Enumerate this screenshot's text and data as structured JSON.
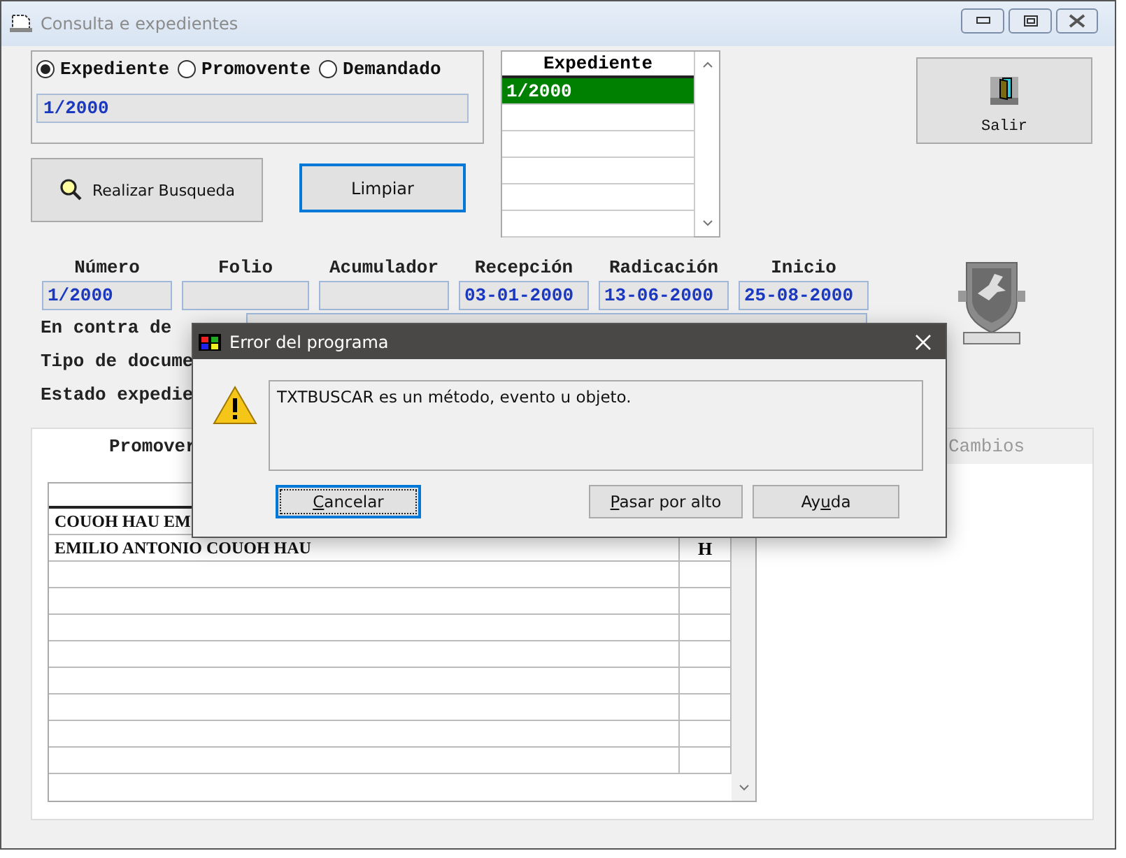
{
  "window": {
    "title": "Consulta e expedientes"
  },
  "search": {
    "options": [
      {
        "label": "Expediente",
        "selected": true
      },
      {
        "label": "Promovente",
        "selected": false
      },
      {
        "label": "Demandado",
        "selected": false
      }
    ],
    "value": "1/2000"
  },
  "search_button": {
    "label": "Realizar Busqueda"
  },
  "clear_button": {
    "label": "Limpiar",
    "focused": true
  },
  "exit_button": {
    "label": "Salir"
  },
  "expediente_list": {
    "header": "Expediente",
    "rows": [
      {
        "text": "1/2000",
        "selected": true
      }
    ]
  },
  "fields": [
    {
      "label": "Número",
      "value": "1/2000"
    },
    {
      "label": "Folio"
    },
    {
      "label": "Acumulador"
    },
    {
      "label": "Recepción",
      "value": "03-01-2000"
    },
    {
      "label": "Radicación",
      "value": "13-06-2000"
    },
    {
      "label": "Inicio",
      "value": "25-08-2000"
    }
  ],
  "info_labels": [
    "En contra de",
    "Tipo de docume",
    "Estado expedie"
  ],
  "tabs": [
    {
      "label": "Promover",
      "selected": true
    },
    {
      "label": "Cambios",
      "selected": false
    }
  ],
  "grid_rows": [
    {
      "name": "COUOH HAU EM"
    },
    {
      "name": "EMILIO ANTONIO COUOH HAU",
      "column_2": "H"
    }
  ],
  "dialog": {
    "title": "Error del programa",
    "message": "TXTBUSCAR es un método, evento u objeto.",
    "buttons": [
      {
        "parts": [
          {
            "text": "C",
            "underline": true
          },
          {
            "text": "ancelar",
            "underline": false
          }
        ],
        "focused": true
      },
      {
        "parts": [
          {
            "text": "P",
            "underline": true
          },
          {
            "text": "asar por alto",
            "underline": false
          }
        ],
        "focused": false
      },
      {
        "parts": [
          {
            "text": "Ay",
            "underline": false
          },
          {
            "text": "u",
            "underline": true
          },
          {
            "text": "da",
            "underline": false
          }
        ],
        "focused": false
      }
    ]
  }
}
